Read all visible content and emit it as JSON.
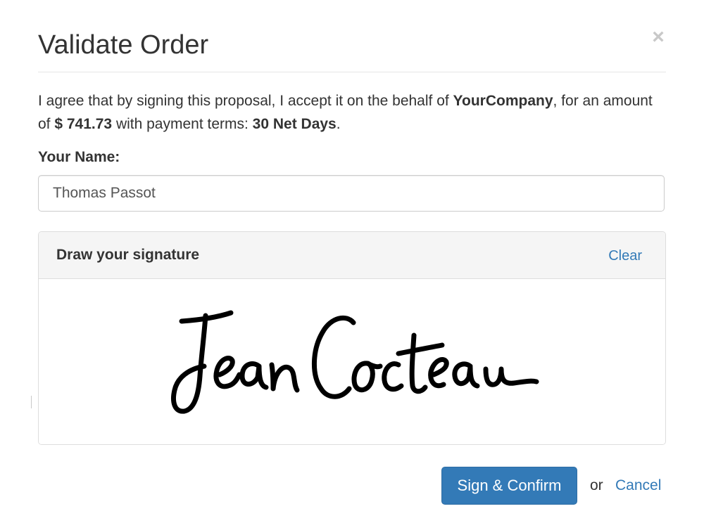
{
  "dialog": {
    "title": "Validate Order",
    "close_symbol": "×"
  },
  "agreement": {
    "text_1": "I agree that by signing this proposal, I accept it on the behalf of ",
    "company": "YourCompany",
    "text_2": ", for an amount of ",
    "amount": "$ 741.73",
    "text_3": " with payment terms: ",
    "payment_terms": "30 Net Days",
    "text_4": "."
  },
  "name_field": {
    "label": "Your Name:",
    "value": "Thomas Passot"
  },
  "signature_panel": {
    "title": "Draw your signature",
    "clear_label": "Clear",
    "signature_text": "Jean Cocteau",
    "ink_color": "#000000"
  },
  "footer": {
    "confirm_label": "Sign & Confirm",
    "or_text": "or",
    "cancel_label": "Cancel"
  },
  "colors": {
    "primary": "#337ab7",
    "text": "#333333",
    "panel_heading_bg": "#f5f5f5",
    "border": "#dddddd"
  }
}
